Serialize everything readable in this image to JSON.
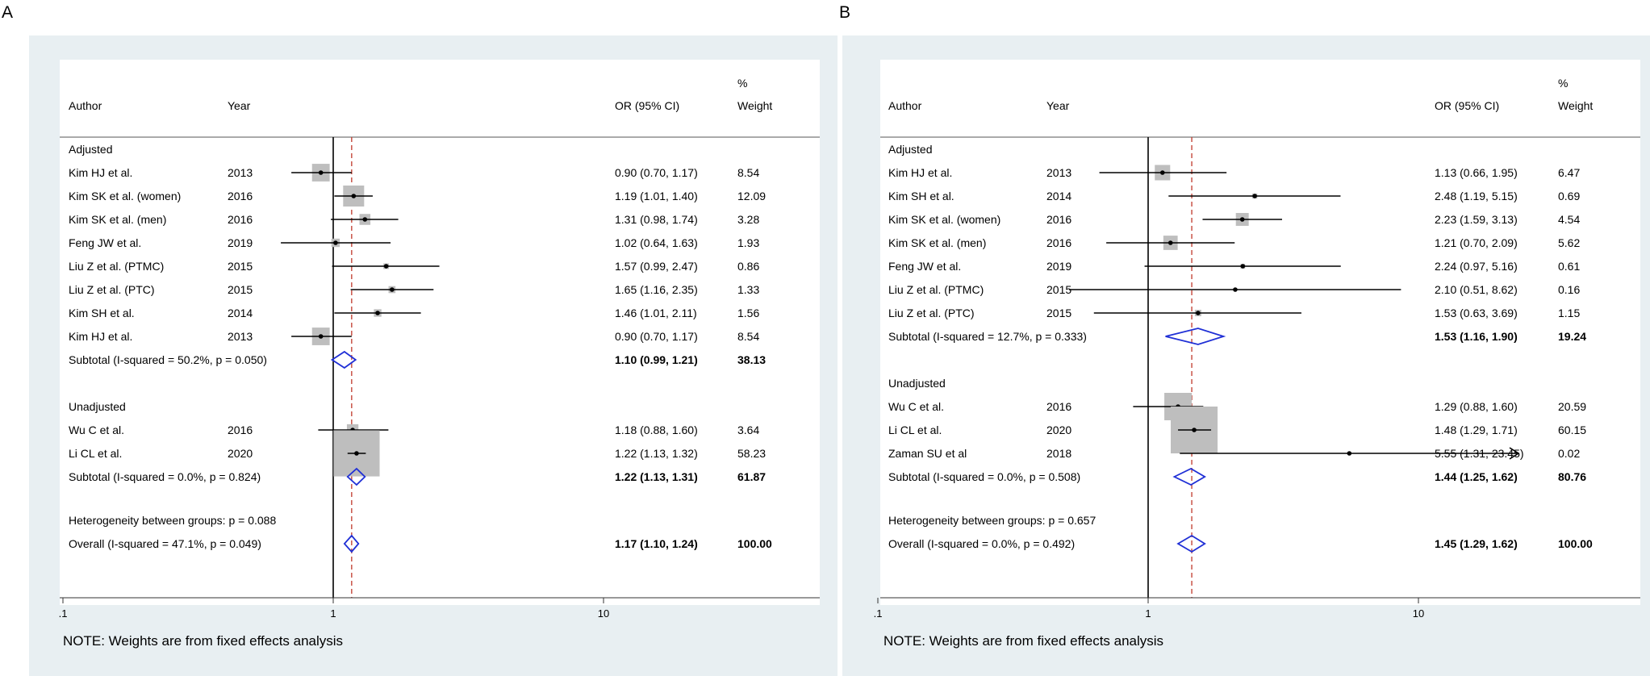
{
  "panels": [
    {
      "letter": "A",
      "headers": {
        "author": "Author",
        "year": "Year",
        "or_ci": "OR (95% CI)",
        "weight_line1": "%",
        "weight_line2": "Weight"
      },
      "ticks": [
        {
          "value": 0.1,
          "label": ".1"
        },
        {
          "value": 1,
          "label": "1"
        },
        {
          "value": 10,
          "label": "10"
        }
      ],
      "note": "NOTE: Weights are from fixed effects analysis",
      "heterogeneity": "Heterogeneity between groups: p = 0.088",
      "overall": {
        "label": "Overall  (I-squared = 47.1%, p = 0.049)",
        "or": 1.17,
        "lo": 1.1,
        "hi": 1.24,
        "text": "1.17 (1.10, 1.24)",
        "weight": "100.00"
      },
      "groups": [
        {
          "name": "Adjusted",
          "studies": [
            {
              "author": "Kim HJ et al.",
              "year": "2013",
              "or": 0.9,
              "lo": 0.7,
              "hi": 1.17,
              "text": "0.90 (0.70, 1.17)",
              "weight": "8.54"
            },
            {
              "author": "Kim SK et al. (women)",
              "year": "2016",
              "or": 1.19,
              "lo": 1.01,
              "hi": 1.4,
              "text": "1.19 (1.01, 1.40)",
              "weight": "12.09"
            },
            {
              "author": "Kim SK et al. (men)",
              "year": "2016",
              "or": 1.31,
              "lo": 0.98,
              "hi": 1.74,
              "text": "1.31 (0.98, 1.74)",
              "weight": "3.28"
            },
            {
              "author": "Feng JW et al.",
              "year": "2019",
              "or": 1.02,
              "lo": 0.64,
              "hi": 1.63,
              "text": "1.02 (0.64, 1.63)",
              "weight": "1.93"
            },
            {
              "author": "Liu Z et al. (PTMC)",
              "year": "2015",
              "or": 1.57,
              "lo": 0.99,
              "hi": 2.47,
              "text": "1.57 (0.99, 2.47)",
              "weight": "0.86"
            },
            {
              "author": "Liu Z et al. (PTC)",
              "year": "2015",
              "or": 1.65,
              "lo": 1.16,
              "hi": 2.35,
              "text": "1.65 (1.16, 2.35)",
              "weight": "1.33"
            },
            {
              "author": "Kim SH et al.",
              "year": "2014",
              "or": 1.46,
              "lo": 1.01,
              "hi": 2.11,
              "text": "1.46 (1.01, 2.11)",
              "weight": "1.56"
            },
            {
              "author": "Kim HJ et al.",
              "year": "2013",
              "or": 0.9,
              "lo": 0.7,
              "hi": 1.17,
              "text": "0.90 (0.70, 1.17)",
              "weight": "8.54"
            }
          ],
          "subtotal": {
            "label": "Subtotal  (I-squared = 50.2%, p = 0.050)",
            "or": 1.1,
            "lo": 0.99,
            "hi": 1.21,
            "text": "1.10 (0.99, 1.21)",
            "weight": "38.13"
          }
        },
        {
          "name": "Unadjusted",
          "studies": [
            {
              "author": "Wu C et al.",
              "year": "2016",
              "or": 1.18,
              "lo": 0.88,
              "hi": 1.6,
              "text": "1.18 (0.88, 1.60)",
              "weight": "3.64"
            },
            {
              "author": "Li CL et al.",
              "year": "2020",
              "or": 1.22,
              "lo": 1.13,
              "hi": 1.32,
              "text": "1.22 (1.13, 1.32)",
              "weight": "58.23"
            }
          ],
          "subtotal": {
            "label": "Subtotal  (I-squared = 0.0%, p = 0.824)",
            "or": 1.22,
            "lo": 1.13,
            "hi": 1.31,
            "text": "1.22 (1.13, 1.31)",
            "weight": "61.87"
          }
        }
      ]
    },
    {
      "letter": "B",
      "headers": {
        "author": "Author",
        "year": "Year",
        "or_ci": "OR (95% CI)",
        "weight_line1": "%",
        "weight_line2": "Weight"
      },
      "ticks": [
        {
          "value": 0.1,
          "label": ".1"
        },
        {
          "value": 1,
          "label": "1"
        },
        {
          "value": 10,
          "label": "10"
        }
      ],
      "note": "NOTE: Weights are from fixed effects analysis",
      "heterogeneity": "Heterogeneity between groups: p = 0.657",
      "overall": {
        "label": "Overall  (I-squared = 0.0%, p = 0.492)",
        "or": 1.45,
        "lo": 1.29,
        "hi": 1.62,
        "text": "1.45 (1.29, 1.62)",
        "weight": "100.00"
      },
      "groups": [
        {
          "name": "Adjusted",
          "studies": [
            {
              "author": "Kim HJ et al.",
              "year": "2013",
              "or": 1.13,
              "lo": 0.66,
              "hi": 1.95,
              "text": "1.13 (0.66, 1.95)",
              "weight": "6.47"
            },
            {
              "author": "Kim SH et al.",
              "year": "2014",
              "or": 2.48,
              "lo": 1.19,
              "hi": 5.15,
              "text": "2.48 (1.19, 5.15)",
              "weight": "0.69"
            },
            {
              "author": "Kim SK et al. (women)",
              "year": "2016",
              "or": 2.23,
              "lo": 1.59,
              "hi": 3.13,
              "text": "2.23 (1.59, 3.13)",
              "weight": "4.54"
            },
            {
              "author": "Kim SK et al. (men)",
              "year": "2016",
              "or": 1.21,
              "lo": 0.7,
              "hi": 2.09,
              "text": "1.21 (0.70, 2.09)",
              "weight": "5.62"
            },
            {
              "author": "Feng JW et al.",
              "year": "2019",
              "or": 2.24,
              "lo": 0.97,
              "hi": 5.16,
              "text": "2.24 (0.97, 5.16)",
              "weight": "0.61"
            },
            {
              "author": "Liu Z et al. (PTMC)",
              "year": "2015",
              "or": 2.1,
              "lo": 0.51,
              "hi": 8.62,
              "text": "2.10 (0.51, 8.62)",
              "weight": "0.16"
            },
            {
              "author": "Liu Z et al. (PTC)",
              "year": "2015",
              "or": 1.53,
              "lo": 0.63,
              "hi": 3.69,
              "text": "1.53 (0.63, 3.69)",
              "weight": "1.15"
            }
          ],
          "subtotal": {
            "label": "Subtotal  (I-squared = 12.7%, p = 0.333)",
            "or": 1.53,
            "lo": 1.16,
            "hi": 1.9,
            "text": "1.53 (1.16, 1.90)",
            "weight": "19.24"
          }
        },
        {
          "name": "Unadjusted",
          "studies": [
            {
              "author": "Wu C et al.",
              "year": "2016",
              "or": 1.29,
              "lo": 0.88,
              "hi": 1.6,
              "text": "1.29 (0.88, 1.60)",
              "weight": "20.59"
            },
            {
              "author": "Li CL et al.",
              "year": "2020",
              "or": 1.48,
              "lo": 1.29,
              "hi": 1.71,
              "text": "1.48 (1.29, 1.71)",
              "weight": "60.15"
            },
            {
              "author": "Zaman SU et al",
              "year": "2018",
              "or": 5.55,
              "lo": 1.31,
              "hi": 23.45,
              "text": "5.55 (1.31, 23.45)",
              "weight": "0.02",
              "arrow": true
            }
          ],
          "subtotal": {
            "label": "Subtotal  (I-squared = 0.0%, p = 0.508)",
            "or": 1.44,
            "lo": 1.25,
            "hi": 1.62,
            "text": "1.44 (1.25, 1.62)",
            "weight": "80.76"
          }
        }
      ]
    }
  ],
  "colors": {
    "panel_bg": "#e8eff2",
    "box": "#bebebe",
    "diamond": "#1f2fd6",
    "reference_dash": "#c0392b",
    "line": "#000000"
  }
}
